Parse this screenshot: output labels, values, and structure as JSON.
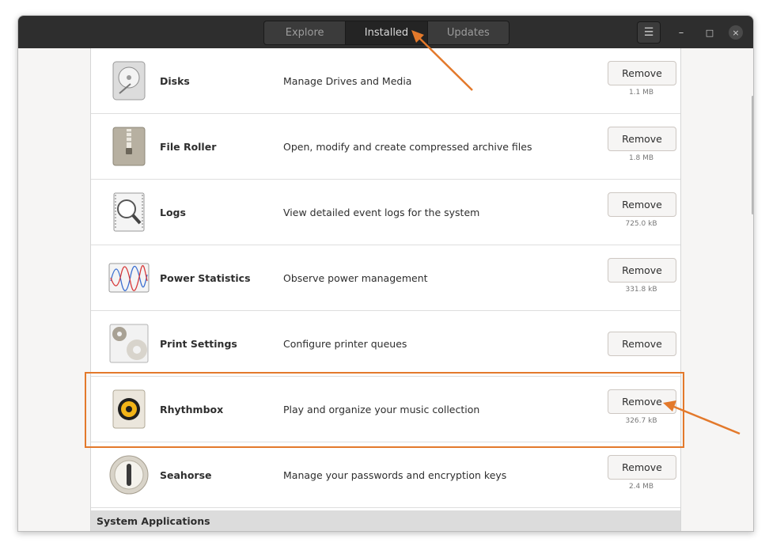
{
  "header": {
    "tabs": [
      {
        "label": "Explore"
      },
      {
        "label": "Installed"
      },
      {
        "label": "Updates"
      }
    ],
    "menu_icon": "hamburger-menu-icon",
    "window_controls": {
      "minimize": "–",
      "maximize": "□",
      "close": "×"
    }
  },
  "apps": [
    {
      "name": "Disks",
      "description": "Manage Drives and Media",
      "button": "Remove",
      "size": "1.1 MB",
      "icon": "disks-icon"
    },
    {
      "name": "File Roller",
      "description": "Open, modify and create compressed archive files",
      "button": "Remove",
      "size": "1.8 MB",
      "icon": "file-roller-icon"
    },
    {
      "name": "Logs",
      "description": "View detailed event logs for the system",
      "button": "Remove",
      "size": "725.0 kB",
      "icon": "logs-icon"
    },
    {
      "name": "Power Statistics",
      "description": "Observe power management",
      "button": "Remove",
      "size": "331.8 kB",
      "icon": "power-statistics-icon"
    },
    {
      "name": "Print Settings",
      "description": "Configure printer queues",
      "button": "Remove",
      "size": "",
      "icon": "print-settings-icon"
    },
    {
      "name": "Rhythmbox",
      "description": "Play and organize your music collection",
      "button": "Remove",
      "size": "326.7 kB",
      "icon": "rhythmbox-icon"
    },
    {
      "name": "Seahorse",
      "description": "Manage your passwords and encryption keys",
      "button": "Remove",
      "size": "2.4 MB",
      "icon": "seahorse-icon"
    }
  ],
  "section_header": "System Applications",
  "colors": {
    "accent_annotation": "#e3792b",
    "headerbar": "#2e2e2e"
  }
}
